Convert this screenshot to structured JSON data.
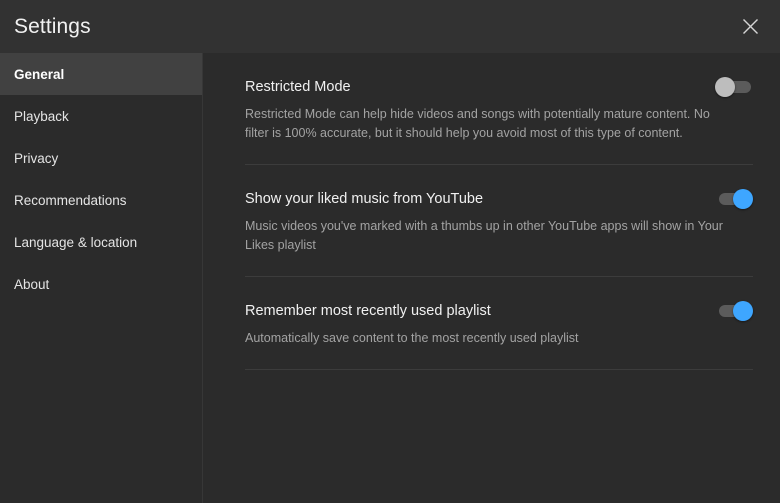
{
  "header": {
    "title": "Settings",
    "close_icon": "close-icon"
  },
  "sidebar": {
    "items": [
      {
        "label": "General",
        "selected": true
      },
      {
        "label": "Playback",
        "selected": false
      },
      {
        "label": "Privacy",
        "selected": false
      },
      {
        "label": "Recommendations",
        "selected": false
      },
      {
        "label": "Language & location",
        "selected": false
      },
      {
        "label": "About",
        "selected": false
      }
    ]
  },
  "main": {
    "settings": [
      {
        "title": "Restricted Mode",
        "description": "Restricted Mode can help hide videos and songs with potentially mature content. No filter is 100% accurate, but it should help you avoid most of this type of content.",
        "toggle_state": "off"
      },
      {
        "title": "Show your liked music from YouTube",
        "description": "Music videos you've marked with a thumbs up in other YouTube apps will show in Your Likes playlist",
        "toggle_state": "on"
      },
      {
        "title": "Remember most recently used playlist",
        "description": "Automatically save content to the most recently used playlist",
        "toggle_state": "on"
      }
    ]
  },
  "colors": {
    "accent": "#3ea6ff",
    "background": "#2b2b2b",
    "header_background": "#323232",
    "selected_item_background": "#414141",
    "toggle_off_knob": "#bdbdbd",
    "toggle_track": "#5b5b5b",
    "divider": "#3c3c3c",
    "title_text": "#f1f1f1",
    "description_text": "#a3a3a3"
  }
}
